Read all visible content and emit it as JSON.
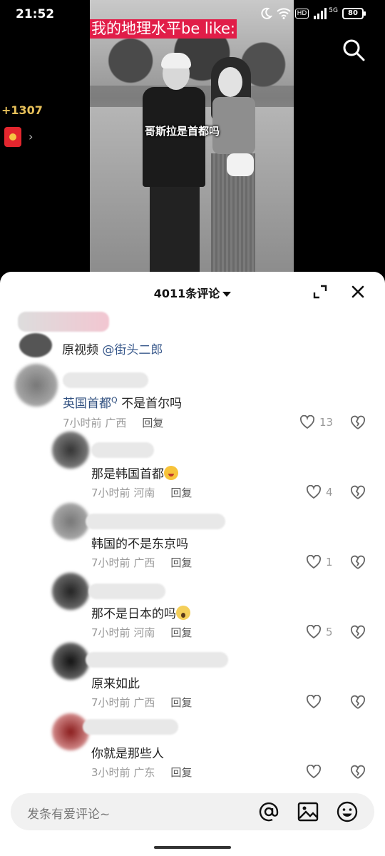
{
  "status_bar": {
    "time": "21:52",
    "network_badge": "HD",
    "network_type": "5G",
    "battery": "80"
  },
  "video": {
    "title_overlay": "我的地理水平be like:",
    "caption": "哥斯拉是首都吗"
  },
  "side": {
    "coins": "+1307",
    "redpacket_arrow": "›"
  },
  "panel": {
    "comment_count": "4011条评论",
    "original_video_label": "原视频",
    "original_video_author": "@街头二郎"
  },
  "comments": [
    {
      "text_link": "英国首都",
      "text_rest": " 不是首尔吗",
      "time": "7小时前",
      "location": "广西",
      "reply_label": "回复",
      "likes": "13",
      "emoji": ""
    },
    {
      "text": "那是韩国首都",
      "emoji": "laugh",
      "time": "7小时前",
      "location": "河南",
      "reply_label": "回复",
      "likes": "4"
    },
    {
      "text": "韩国的不是东京吗",
      "emoji": "",
      "time": "7小时前",
      "location": "广西",
      "reply_label": "回复",
      "likes": "1"
    },
    {
      "text": "那不是日本的吗",
      "emoji": "scream",
      "time": "7小时前",
      "location": "河南",
      "reply_label": "回复",
      "likes": "5"
    },
    {
      "text": "原来如此",
      "emoji": "",
      "time": "7小时前",
      "location": "广西",
      "reply_label": "回复",
      "likes": ""
    },
    {
      "text": "你就是那些人",
      "emoji": "",
      "time": "3小时前",
      "location": "广东",
      "reply_label": "回复",
      "likes": ""
    }
  ],
  "input": {
    "placeholder": "发条有爱评论~"
  },
  "icons": {
    "search": "search-icon",
    "expand": "expand-icon",
    "close": "close-icon",
    "like": "heart-icon",
    "dislike": "broken-heart-icon",
    "at": "at-icon",
    "image": "image-icon",
    "emoji": "smile-icon"
  },
  "colors": {
    "title_bg": "#e11d48",
    "link": "#2f4f7f",
    "coins": "#e8c15a",
    "redpacket": "#e3262e"
  }
}
